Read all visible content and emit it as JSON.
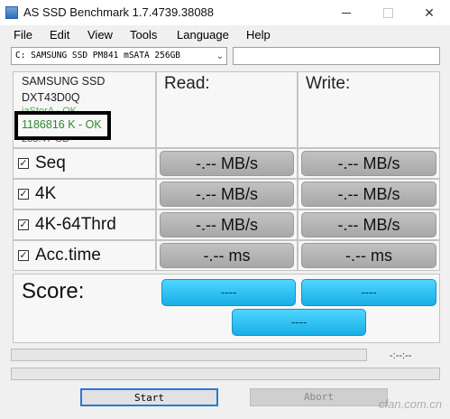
{
  "window": {
    "title": "AS SSD Benchmark 1.7.4739.38088"
  },
  "menu": [
    "File",
    "Edit",
    "View",
    "Tools",
    "Language",
    "Help"
  ],
  "drive": {
    "selected": "C: SAMSUNG SSD PM841 mSATA 256GB"
  },
  "info": {
    "model": "SAMSUNG SSD",
    "firmware": "DXT43D0Q",
    "alignment_partial": "iaStorA - OK",
    "offset": "1186816 K - OK",
    "size_partial": "238.47 GB"
  },
  "headers": {
    "read": "Read:",
    "write": "Write:"
  },
  "tests": [
    {
      "label": "Seq",
      "checked": true,
      "read": "-.-- MB/s",
      "write": "-.-- MB/s"
    },
    {
      "label": "4K",
      "checked": true,
      "read": "-.-- MB/s",
      "write": "-.-- MB/s"
    },
    {
      "label": "4K-64Thrd",
      "checked": true,
      "read": "-.-- MB/s",
      "write": "-.-- MB/s"
    },
    {
      "label": "Acc.time",
      "checked": true,
      "read": "-.-- ms",
      "write": "-.-- ms"
    }
  ],
  "score": {
    "label": "Score:",
    "read": "----",
    "write": "----",
    "total": "----"
  },
  "timer": "-:--:--",
  "buttons": {
    "start": "Start",
    "abort": "Abort"
  },
  "watermark": "cfan.com.cn"
}
